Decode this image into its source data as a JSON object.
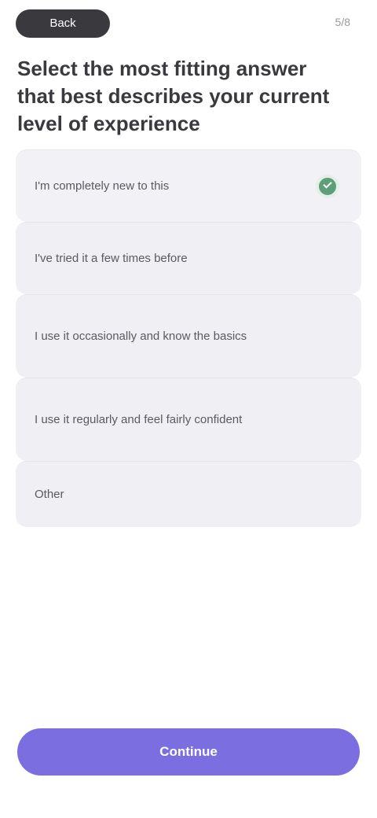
{
  "header": {
    "back_label": "Back",
    "step": "5/8"
  },
  "question": "Select the most fitting answer that best describes your current level of experience",
  "options": [
    {
      "label": "I'm completely new to this",
      "selected": true
    },
    {
      "label": "I've tried it a few times before",
      "selected": false
    },
    {
      "label": "I use it occasionally and know the basics",
      "selected": false
    },
    {
      "label": "I use it regularly and feel fairly confident",
      "selected": false
    },
    {
      "label": "Other",
      "selected": false
    }
  ],
  "cta": {
    "label": "Continue"
  },
  "colors": {
    "accent": "#7b6ee0",
    "selected_check": "#5e9f7a",
    "option_bg": "#f0eff4"
  }
}
